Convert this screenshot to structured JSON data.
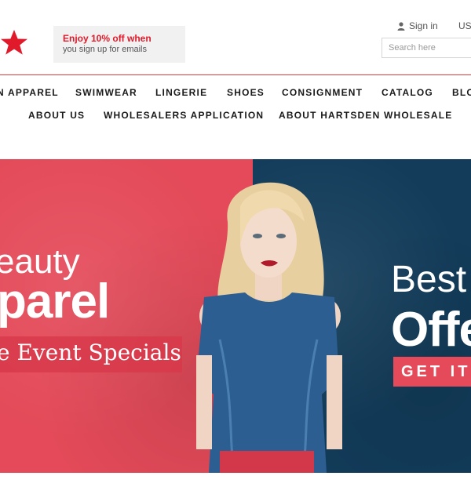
{
  "header": {
    "promo": {
      "title": "Enjoy 10% off when",
      "subtitle": "you sign up for emails"
    },
    "signin_label": "Sign in",
    "language": "US",
    "search_placeholder": "Search here"
  },
  "nav": {
    "row1": [
      "N APPAREL",
      "SWIMWEAR",
      "LINGERIE",
      "SHOES",
      "CONSIGNMENT",
      "CATALOG",
      "BLO"
    ],
    "row2": [
      "ABOUT US",
      "WHOLESALERS APPLICATION",
      "ABOUT HARTSDEN WHOLESALE"
    ]
  },
  "hero": {
    "left_line1": "eauty",
    "left_line2": "parel",
    "left_line3": "e Event Specials",
    "right_line1": "Best",
    "right_line2": "Offe",
    "cta_label": "GET IT"
  },
  "colors": {
    "brand_red": "#e01a2b",
    "hero_left": "#e44a59",
    "hero_right": "#123c5a"
  },
  "icons": {
    "logo": "star-icon",
    "signin": "user-icon"
  }
}
